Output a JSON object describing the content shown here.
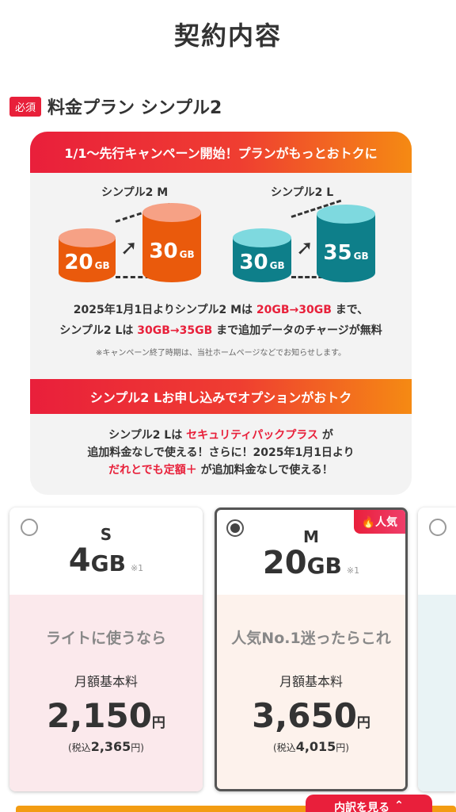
{
  "page": {
    "title": "契約内容"
  },
  "section": {
    "required_badge": "必須",
    "title": "料金プラン シンプル2"
  },
  "campaign": {
    "banner1": "1/1〜先行キャンペーン開始！プランがもっとおトクに",
    "plan_m_label": "シンプル2 M",
    "plan_l_label": "シンプル2 L",
    "m_from": "20",
    "m_to": "30",
    "l_from": "30",
    "l_to": "35",
    "gb_unit": "GB",
    "line1_a": "2025年1月1日よりシンプル2 Mは ",
    "line1_b": "20GB→30GB",
    "line1_c": " まで、",
    "line2_a": "シンプル2 Lは ",
    "line2_b": "30GB→35GB",
    "line2_c": " まで追加データのチャージが無料",
    "note": "※キャンペーン終了時期は、当社ホームページなどでお知らせします。",
    "banner2": "シンプル2 Lお申し込みでオプションがおトク",
    "opt_line1_a": "シンプル2 Lは ",
    "opt_line1_b": "セキュリティパックプラス",
    "opt_line1_c": " が",
    "opt_line2": "追加料金なしで使える！さらに！2025年1月1日より",
    "opt_line3_a": "だれとでも定額＋",
    "opt_line3_b": " が追加料金なしで使える！"
  },
  "plans": [
    {
      "size": "S",
      "data_amount": "4",
      "unit": "GB",
      "note": "※1",
      "tagline": "ライトに使うなら",
      "fee_label": "月額基本料",
      "price": "2,150",
      "yen": "円",
      "tax_prefix": "(税込",
      "tax_price": "2,365",
      "tax_suffix": "円)",
      "selected": false
    },
    {
      "size": "M",
      "data_amount": "20",
      "unit": "GB",
      "note": "※1",
      "tagline": "人気No.1迷ったらこれ",
      "fee_label": "月額基本料",
      "price": "3,650",
      "yen": "円",
      "tax_prefix": "(税込",
      "tax_price": "4,015",
      "tax_suffix": "円)",
      "selected": true,
      "badge": "人気"
    }
  ],
  "details_button": "内訳を見る",
  "colors": {
    "accent_red": "#e8203a",
    "orange": "#ea5a0c",
    "teal": "#0e7f8a"
  }
}
